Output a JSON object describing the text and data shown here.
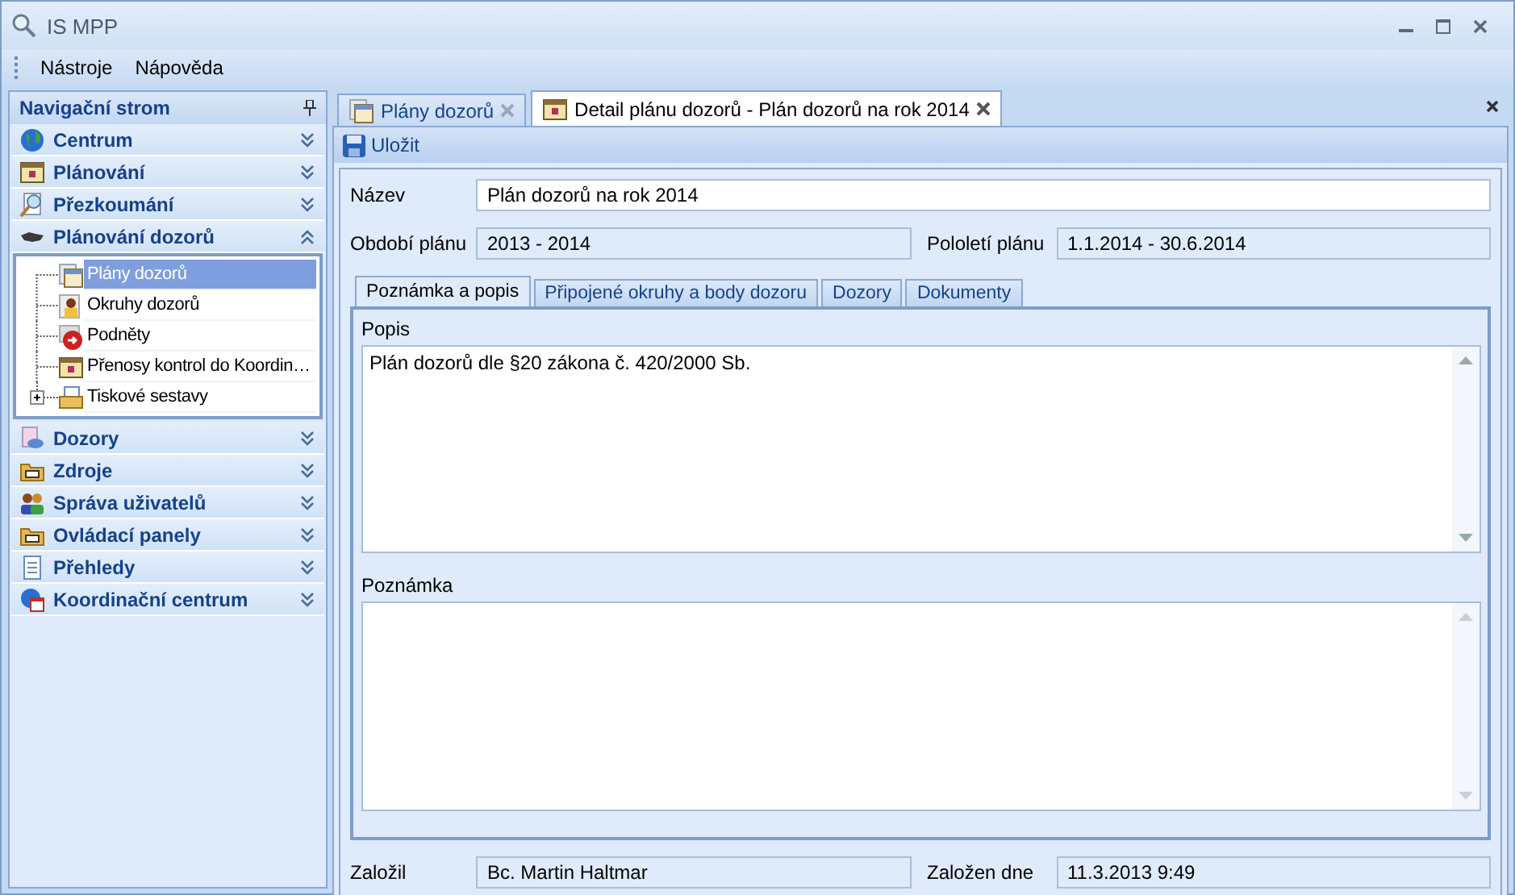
{
  "window": {
    "title": "IS MPP"
  },
  "menu": [
    {
      "label": "Nástroje"
    },
    {
      "label": "Nápověda"
    }
  ],
  "navigator": {
    "title": "Navigační strom",
    "groups": [
      {
        "label": "Centrum",
        "expanded": false
      },
      {
        "label": "Plánování",
        "expanded": false
      },
      {
        "label": "Přezkoumání",
        "expanded": false
      },
      {
        "label": "Plánování dozorů",
        "expanded": true,
        "items": [
          {
            "label": "Plány dozorů",
            "selected": true
          },
          {
            "label": "Okruhy dozorů",
            "selected": false
          },
          {
            "label": "Podněty",
            "selected": false
          },
          {
            "label": "Přenosy kontrol do Koordin…",
            "selected": false
          },
          {
            "label": "Tiskové sestavy",
            "selected": false,
            "expanded": false
          }
        ]
      },
      {
        "label": "Dozory",
        "expanded": false
      },
      {
        "label": "Zdroje",
        "expanded": false
      },
      {
        "label": "Správa uživatelů",
        "expanded": false
      },
      {
        "label": "Ovládací panely",
        "expanded": false
      },
      {
        "label": "Přehledy",
        "expanded": false
      },
      {
        "label": "Koordinační centrum",
        "expanded": false
      }
    ]
  },
  "doc_tabs": [
    {
      "label": "Plány dozorů",
      "selected": false
    },
    {
      "label": "Detail plánu dozorů - Plán dozorů na rok 2014",
      "selected": true
    }
  ],
  "toolbar": {
    "save": "Uložit"
  },
  "form": {
    "name": {
      "label": "Název",
      "value": "Plán dozorů na rok 2014"
    },
    "period": {
      "label": "Období plánu",
      "value": "2013 - 2014"
    },
    "half": {
      "label": "Pololetí plánu",
      "value": "1.1.2014 - 30.6.2014"
    },
    "tabs": [
      {
        "label": "Poznámka a popis",
        "selected": true
      },
      {
        "label": "Připojené okruhy a body dozoru",
        "selected": false
      },
      {
        "label": "Dozory",
        "selected": false
      },
      {
        "label": "Dokumenty",
        "selected": false
      }
    ],
    "description": {
      "label": "Popis",
      "value": "Plán dozorů dle §20 zákona č. 420/2000 Sb."
    },
    "note": {
      "label": "Poznámka"
    },
    "author": {
      "label": "Založil",
      "value": "Bc. Martin Haltmar"
    },
    "created": {
      "label": "Založen dne",
      "value": "11.3.2013 9:49"
    }
  }
}
